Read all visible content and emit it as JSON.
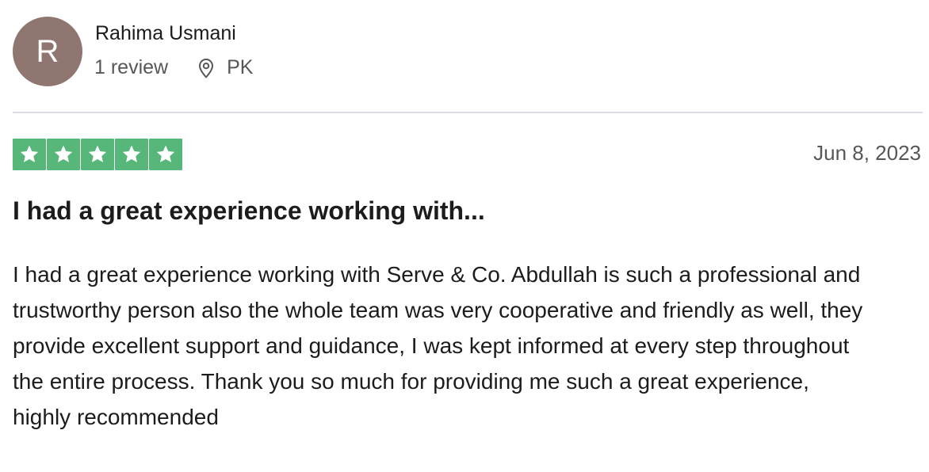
{
  "reviewer": {
    "initial": "R",
    "name": "Rahima Usmani",
    "review_count": "1 review",
    "location": "PK",
    "avatar_color": "#907670"
  },
  "review": {
    "rating": 5,
    "rating_max": 5,
    "star_color": "#57b77a",
    "date": "Jun 8, 2023",
    "title": "I had a great experience working with...",
    "body": "I had a great experience working with Serve & Co. Abdullah is such a professional and trustworthy person also the whole team was very cooperative and friendly as well, they provide excellent support and guidance, I was kept informed at every step throughout the entire process. Thank you so much for providing me such a great experience, highly recommended"
  },
  "icons": {
    "location": "map-pin-icon",
    "star": "star-icon"
  }
}
